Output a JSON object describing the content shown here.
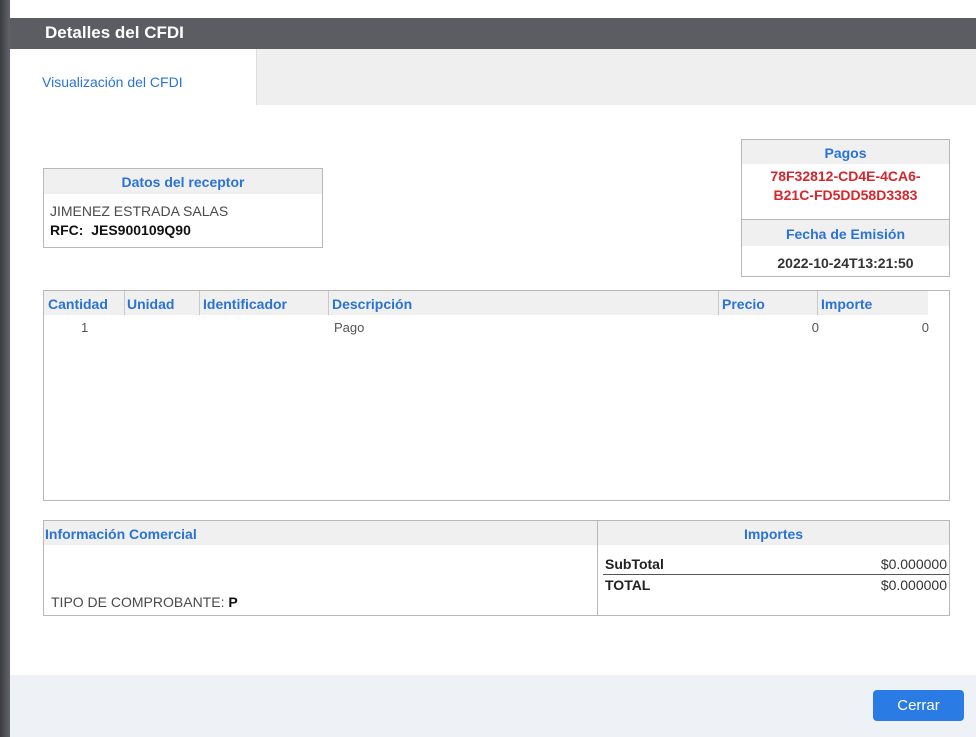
{
  "dialog": {
    "title": "Detalles del CFDI",
    "tab": "Visualización del CFDI"
  },
  "receptor": {
    "header": "Datos del receptor",
    "name": "JIMENEZ ESTRADA SALAS",
    "rfc_label": "RFC:",
    "rfc": "JES900109Q90"
  },
  "pagos": {
    "header": "Pagos",
    "uuid_line1": "78F32812-CD4E-4CA6-",
    "uuid_line2": "B21C-FD5DD58D3383",
    "fecha_header": "Fecha de Emisión",
    "fecha": "2022-10-24T13:21:50"
  },
  "items_table": {
    "columns": [
      "Cantidad",
      "Unidad",
      "Identificador",
      "Descripción",
      "Precio",
      "Importe"
    ],
    "rows": [
      {
        "cantidad": "1",
        "unidad": "",
        "identificador": "",
        "descripcion": "Pago",
        "precio": "0",
        "importe": "0"
      }
    ]
  },
  "comercial": {
    "header": "Información Comercial",
    "tipo_label": "TIPO DE COMPROBANTE:",
    "tipo_value": "P"
  },
  "importes": {
    "header": "Importes",
    "subtotal_label": "SubTotal",
    "subtotal_value": "$0.000000",
    "total_label": "TOTAL",
    "total_value": "$0.000000"
  },
  "footer": {
    "close_label": "Cerrar"
  },
  "colors": {
    "accent": "#2a73d6",
    "uuid_red": "#d6262b",
    "titlebar": "#5b5d63",
    "button": "#2a7be4"
  }
}
